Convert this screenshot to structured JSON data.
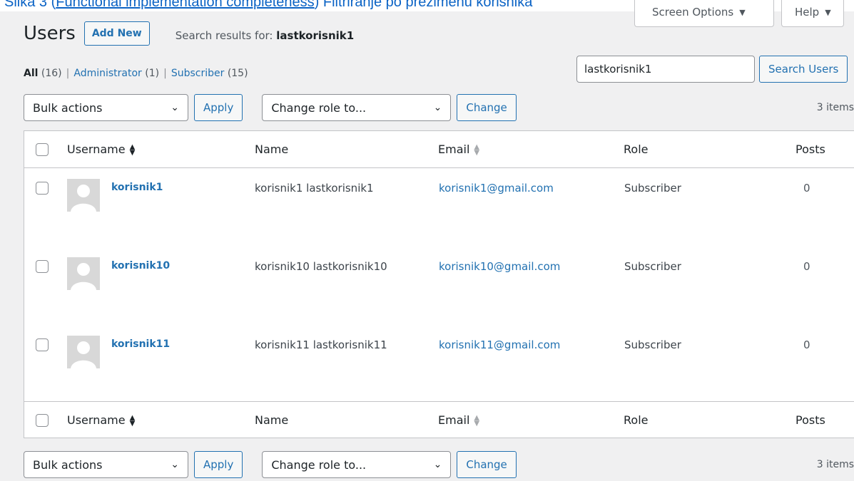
{
  "caption": {
    "prefix": "Slika 3 (",
    "link": "Functional implementation completeness",
    "suffix": ") Filtriranje po prezimenu korisnika"
  },
  "screen_meta": {
    "screen_options": "Screen Options",
    "help": "Help"
  },
  "header": {
    "title": "Users",
    "add_new": "Add New",
    "search_results_label": "Search results for:",
    "search_term": "lastkorisnik1"
  },
  "filters": [
    {
      "label": "All",
      "count": "(16)",
      "current": true
    },
    {
      "label": "Administrator",
      "count": "(1)",
      "current": false
    },
    {
      "label": "Subscriber",
      "count": "(15)",
      "current": false
    }
  ],
  "search": {
    "value": "lastkorisnik1",
    "button": "Search Users"
  },
  "tablenav": {
    "bulk_actions": "Bulk actions",
    "apply": "Apply",
    "change_role": "Change role to...",
    "change": "Change",
    "items": "3 items"
  },
  "columns": {
    "username": "Username",
    "name": "Name",
    "email": "Email",
    "role": "Role",
    "posts": "Posts"
  },
  "users": [
    {
      "username": "korisnik1",
      "name": "korisnik1 lastkorisnik1",
      "email": "korisnik1@gmail.com",
      "role": "Subscriber",
      "posts": "0"
    },
    {
      "username": "korisnik10",
      "name": "korisnik10 lastkorisnik10",
      "email": "korisnik10@gmail.com",
      "role": "Subscriber",
      "posts": "0"
    },
    {
      "username": "korisnik11",
      "name": "korisnik11 lastkorisnik11",
      "email": "korisnik11@gmail.com",
      "role": "Subscriber",
      "posts": "0"
    }
  ],
  "icons": {
    "dropdown": "chevron-down-icon",
    "sort_asc": "sort-up-icon",
    "sortable": "sort-both-icon",
    "avatar": "default-avatar-icon"
  }
}
